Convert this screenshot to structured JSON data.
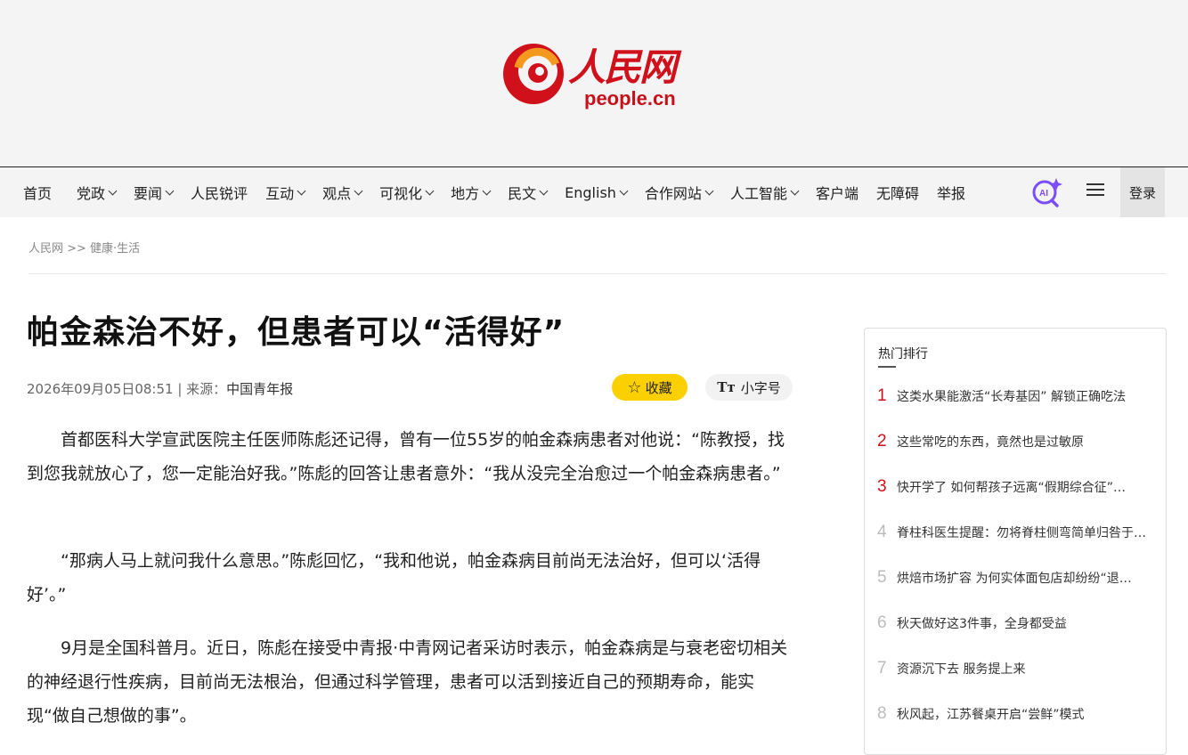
{
  "header": {
    "logo_cn": "人民网",
    "logo_en": "people.cn"
  },
  "nav": {
    "items": [
      {
        "label": "首页",
        "dropdown": false
      },
      {
        "label": "党政",
        "dropdown": true
      },
      {
        "label": "要闻",
        "dropdown": true
      },
      {
        "label": "人民锐评",
        "dropdown": false
      },
      {
        "label": "互动",
        "dropdown": true
      },
      {
        "label": "观点",
        "dropdown": true
      },
      {
        "label": "可视化",
        "dropdown": true
      },
      {
        "label": "地方",
        "dropdown": true
      },
      {
        "label": "民文",
        "dropdown": true
      },
      {
        "label": "English",
        "dropdown": true
      },
      {
        "label": "合作网站",
        "dropdown": true
      },
      {
        "label": "人工智能",
        "dropdown": true
      },
      {
        "label": "客户端",
        "dropdown": false
      },
      {
        "label": "无障碍",
        "dropdown": false
      },
      {
        "label": "举报",
        "dropdown": false
      }
    ],
    "ai_icon": "ai-search-icon",
    "menu_icon": "hamburger-menu-icon",
    "login_label": "登录"
  },
  "breadcrumb": "人民网 >> 健康·生活",
  "article": {
    "title": "帕金森治不好，但患者可以“活得好”",
    "date": "2026年09月05日08:51",
    "source_prefix": " | 来源：",
    "source": "中国青年报",
    "fav_label": "收藏",
    "font_label": "小字号",
    "paragraphs": [
      "首都医科大学宣武医院主任医师陈彪还记得，曾有一位55岁的帕金森病患者对他说：“陈教授，找到您我就放心了，您一定能治好我。”陈彪的回答让患者意外：“我从没完全治愈过一个帕金森病患者。”",
      "“那病人马上就问我什么意思。”陈彪回忆，“我和他说，帕金森病目前尚无法治好，但可以‘活得好’。”",
      "9月是全国科普月。近日，陈彪在接受中青报·中青网记者采访时表示，帕金森病是与衰老密切相关的神经退行性疾病，目前尚无法根治，但通过科学管理，患者可以活到接近自己的预期寿命，能实现“做自己想做的事”。"
    ]
  },
  "sidebar": {
    "title": "热门排行",
    "items": [
      {
        "rank": "1",
        "text": "这类水果能激活“长寿基因” 解锁正确吃法"
      },
      {
        "rank": "2",
        "text": "这些常吃的东西，竟然也是过敏原"
      },
      {
        "rank": "3",
        "text": "快开学了 如何帮孩子远离“假期综合征”…"
      },
      {
        "rank": "4",
        "text": "脊柱科医生提醒：勿将脊柱侧弯简单归咎于…"
      },
      {
        "rank": "5",
        "text": "烘焙市场扩容 为何实体面包店却纷纷“退…"
      },
      {
        "rank": "6",
        "text": "秋天做好这3件事，全身都受益"
      },
      {
        "rank": "7",
        "text": " 资源沉下去 服务提上来"
      },
      {
        "rank": "8",
        "text": "秋风起，江苏餐桌开启“尝鲜”模式"
      }
    ]
  },
  "colors": {
    "brand_red": "#d0101a",
    "fav_yellow": "#fbd000"
  }
}
